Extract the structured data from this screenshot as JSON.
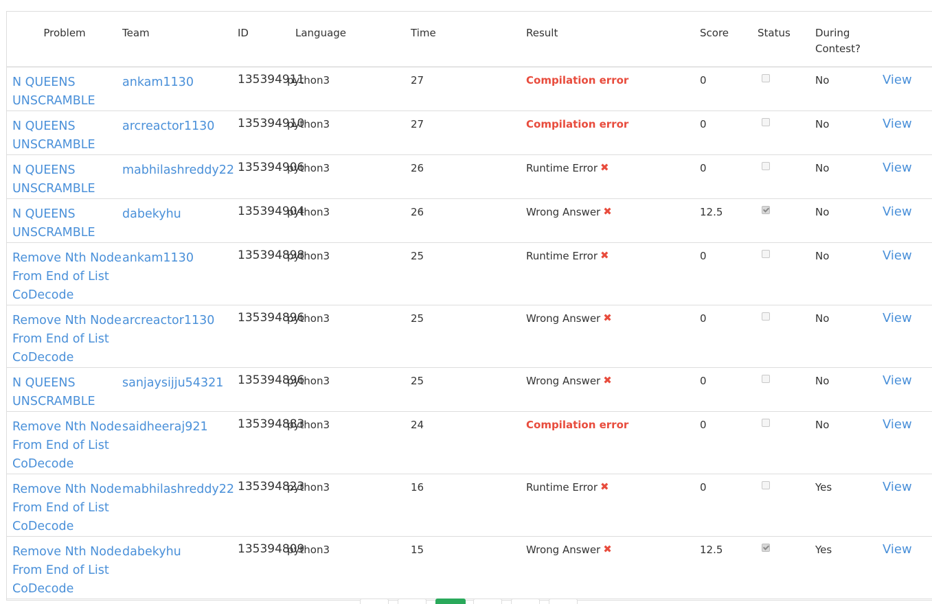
{
  "headers": {
    "problem": "Problem",
    "team": "Team",
    "id": "ID",
    "language": "Language",
    "time": "Time",
    "result": "Result",
    "score": "Score",
    "status": "Status",
    "during_contest": "During Contest?"
  },
  "view_label": "View",
  "rows": [
    {
      "problem": "N QUEENS UNSCRAMBLE",
      "team": "ankam1130",
      "id": "135394911",
      "language": "python3",
      "time": "27",
      "result": "Compilation error",
      "score": "0",
      "status_checked": false,
      "during": "No"
    },
    {
      "problem": "N QUEENS UNSCRAMBLE",
      "team": "arcreactor1130",
      "id": "135394910",
      "language": "python3",
      "time": "27",
      "result": "Compilation error",
      "score": "0",
      "status_checked": false,
      "during": "No"
    },
    {
      "problem": "N QUEENS UNSCRAMBLE",
      "team": "mabhilashreddy22",
      "id": "135394906",
      "language": "python3",
      "time": "26",
      "result": "Runtime Error",
      "score": "0",
      "status_checked": false,
      "during": "No"
    },
    {
      "problem": "N QUEENS UNSCRAMBLE",
      "team": "dabekyhu",
      "id": "135394904",
      "language": "python3",
      "time": "26",
      "result": "Wrong Answer",
      "score": "12.5",
      "status_checked": true,
      "during": "No"
    },
    {
      "problem": "Remove Nth Node From End of List CoDecode",
      "team": "ankam1130",
      "id": "135394898",
      "language": "python3",
      "time": "25",
      "result": "Runtime Error",
      "score": "0",
      "status_checked": false,
      "during": "No"
    },
    {
      "problem": "Remove Nth Node From End of List CoDecode",
      "team": "arcreactor1130",
      "id": "135394896",
      "language": "python3",
      "time": "25",
      "result": "Wrong Answer",
      "score": "0",
      "status_checked": false,
      "during": "No"
    },
    {
      "problem": "N QUEENS UNSCRAMBLE",
      "team": "sanjaysijju54321",
      "id": "135394896",
      "language": "python3",
      "time": "25",
      "result": "Wrong Answer",
      "score": "0",
      "status_checked": false,
      "during": "No"
    },
    {
      "problem": "Remove Nth Node From End of List CoDecode",
      "team": "saidheeraj921",
      "id": "135394883",
      "language": "python3",
      "time": "24",
      "result": "Compilation error",
      "score": "0",
      "status_checked": false,
      "during": "No"
    },
    {
      "problem": "Remove Nth Node From End of List CoDecode",
      "team": "mabhilashreddy22",
      "id": "135394823",
      "language": "python3",
      "time": "16",
      "result": "Runtime Error",
      "score": "0",
      "status_checked": false,
      "during": "Yes"
    },
    {
      "problem": "Remove Nth Node From End of List CoDecode",
      "team": "dabekyhu",
      "id": "135394809",
      "language": "python3",
      "time": "15",
      "result": "Wrong Answer",
      "score": "12.5",
      "status_checked": true,
      "during": "Yes"
    }
  ],
  "colors": {
    "link": "#4a90d9",
    "error": "#e84c3d",
    "active_page": "#2aa95b"
  }
}
